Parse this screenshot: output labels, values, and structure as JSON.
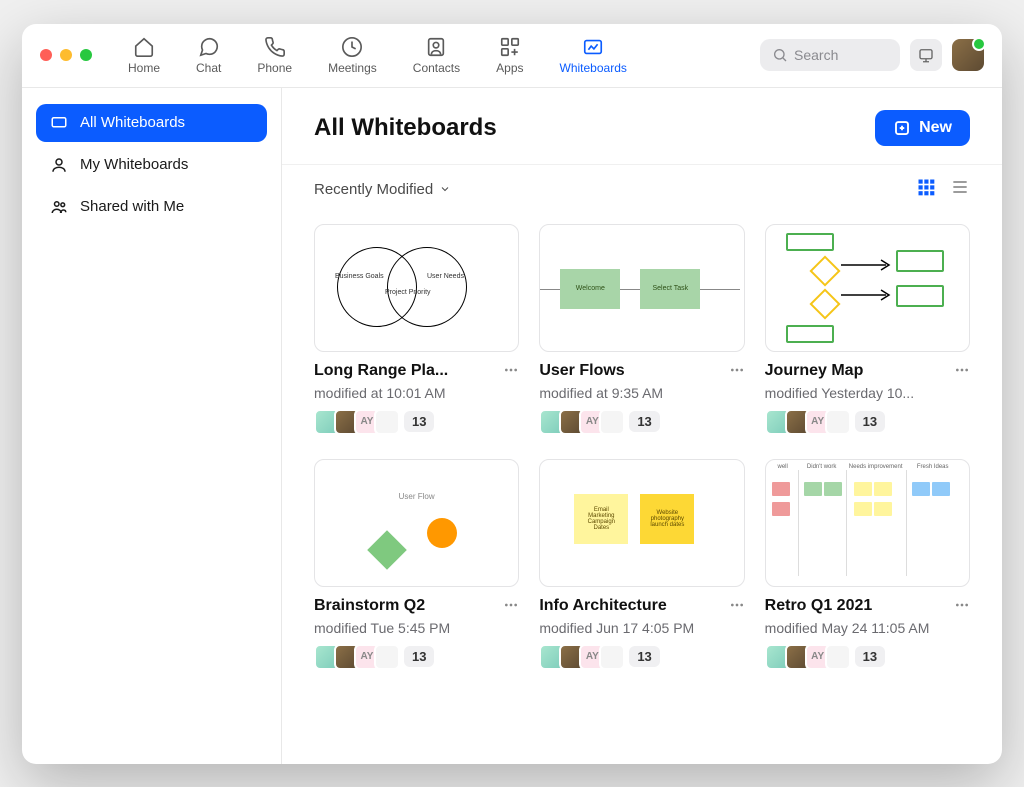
{
  "nav": {
    "home": "Home",
    "chat": "Chat",
    "phone": "Phone",
    "meetings": "Meetings",
    "contacts": "Contacts",
    "apps": "Apps",
    "whiteboards": "Whiteboards"
  },
  "search_placeholder": "Search",
  "sidebar": {
    "all": "All Whiteboards",
    "my": "My Whiteboards",
    "shared": "Shared with Me"
  },
  "page_title": "All Whiteboards",
  "new_button": "New",
  "sort_label": "Recently Modified",
  "collaborator_initials": "AY",
  "collaborator_count": "13",
  "cards": [
    {
      "title": "Long Range Pla...",
      "subtitle": "modified at 10:01 AM"
    },
    {
      "title": "User Flows",
      "subtitle": "modified at 9:35 AM"
    },
    {
      "title": "Journey Map",
      "subtitle": "modified Yesterday 10..."
    },
    {
      "title": "Brainstorm Q2",
      "subtitle": "modified Tue 5:45 PM"
    },
    {
      "title": "Info Architecture",
      "subtitle": "modified Jun 17 4:05 PM"
    },
    {
      "title": "Retro Q1 2021",
      "subtitle": "modified May 24 11:05 AM"
    }
  ],
  "thumb_text": {
    "venn_left": "Business Goals",
    "venn_right": "User Needs",
    "venn_center": "Project Priority",
    "flow_welcome": "Welcome",
    "flow_select": "Select Task",
    "bs_label": "User Flow",
    "sticky1": "Email Marketing Campaign Dates",
    "sticky2": "Website photography launch dates",
    "retro_well": "well",
    "retro_didnt": "Didn't work",
    "retro_needs": "Needs improvement",
    "retro_fresh": "Fresh Ideas"
  }
}
